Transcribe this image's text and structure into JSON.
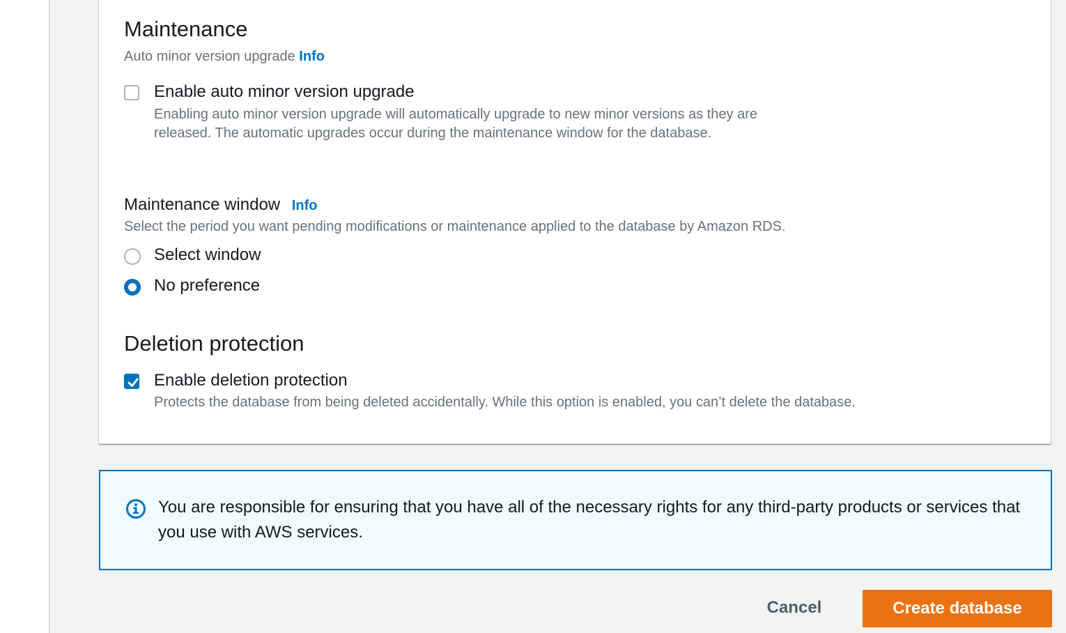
{
  "maintenance": {
    "title": "Maintenance",
    "auto_minor_label": "Auto minor version upgrade",
    "info_link": "Info",
    "auto_minor_checkbox": {
      "checked": false,
      "label": "Enable auto minor version upgrade",
      "description": "Enabling auto minor version upgrade will automatically upgrade to new minor versions as they are released. The automatic upgrades occur during the maintenance window for the database."
    },
    "window": {
      "label": "Maintenance window",
      "info_link": "Info",
      "description": "Select the period you want pending modifications or maintenance applied to the database by Amazon RDS.",
      "options": [
        {
          "label": "Select window",
          "selected": false
        },
        {
          "label": "No preference",
          "selected": true
        }
      ]
    }
  },
  "deletion_protection": {
    "title": "Deletion protection",
    "checkbox": {
      "checked": true,
      "label": "Enable deletion protection",
      "description": "Protects the database from being deleted accidentally. While this option is enabled, you can’t delete the database."
    }
  },
  "alert": {
    "icon": "info-circle-icon",
    "text": "You are responsible for ensuring that you have all of the necessary rights for any third-party products or services that you use with AWS services."
  },
  "actions": {
    "cancel_label": "Cancel",
    "create_label": "Create database"
  },
  "colors": {
    "primary": "#ec7211",
    "link": "#0073bb",
    "info_background": "#f1faff",
    "muted_text": "#687078"
  }
}
